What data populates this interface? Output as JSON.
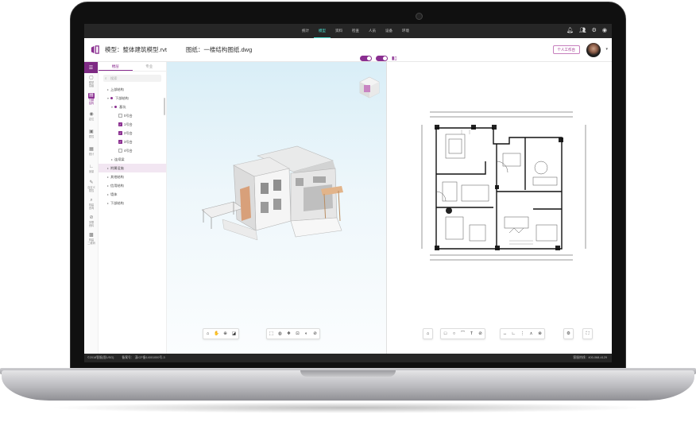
{
  "nav": {
    "links": [
      "统计",
      "模型",
      "资料",
      "检查",
      "人员",
      "设备",
      "环境"
    ],
    "active_index": 1
  },
  "header": {
    "model_label": "模型：整体建筑模型.rvt",
    "drawing_label": "图纸：一楼结构图纸.dwg",
    "workbench_button": "个人工作台"
  },
  "rail": {
    "items": [
      {
        "icon": "cube-icon",
        "glyph": "▢",
        "label": "模型\n层级"
      },
      {
        "icon": "layers-icon",
        "glyph": "▤",
        "label": "分解\n结构",
        "active": true
      },
      {
        "icon": "pin-icon",
        "glyph": "◉",
        "label": "定位"
      },
      {
        "icon": "property-icon",
        "glyph": "▣",
        "label": "属性"
      },
      {
        "icon": "grid-icon",
        "glyph": "▦",
        "label": "统计"
      },
      {
        "icon": "measure-icon",
        "glyph": "∟",
        "label": "测量"
      },
      {
        "icon": "custom-icon",
        "glyph": "✎",
        "label": "自定义\n属性"
      },
      {
        "icon": "search-icon",
        "glyph": "⌕",
        "label": "构建\n查询"
      },
      {
        "icon": "link-icon",
        "glyph": "⊘",
        "label": "关联\n资料"
      },
      {
        "icon": "qr-icon",
        "glyph": "▩",
        "label": "构建\n二维码"
      }
    ]
  },
  "tree": {
    "tabs": [
      "楼层",
      "专业"
    ],
    "active_tab": 0,
    "search_placeholder": "搜索",
    "nodes": [
      {
        "label": "上部结构",
        "indent": 1,
        "arrow": "▸",
        "check": false
      },
      {
        "label": "下部结构",
        "indent": 1,
        "arrow": "▾",
        "check": false,
        "dot": true
      },
      {
        "label": "基坑",
        "indent": 2,
        "arrow": "▾",
        "check": false,
        "dot": true
      },
      {
        "label": "0号台",
        "indent": 3,
        "arrow": "",
        "check": false,
        "box": true
      },
      {
        "label": "1号台",
        "indent": 3,
        "arrow": "",
        "check": true,
        "box": true
      },
      {
        "label": "2号台",
        "indent": 3,
        "arrow": "",
        "check": true,
        "box": true
      },
      {
        "label": "3号台",
        "indent": 3,
        "arrow": "",
        "check": true,
        "box": true
      },
      {
        "label": "4号台",
        "indent": 3,
        "arrow": "",
        "check": false,
        "box": true
      },
      {
        "label": "连续梁",
        "indent": 2,
        "arrow": "▸",
        "check": false
      },
      {
        "label": "附属设施",
        "indent": 1,
        "arrow": "▸",
        "check": false,
        "selected": true
      },
      {
        "label": "其他结构",
        "indent": 1,
        "arrow": "▸",
        "check": false
      },
      {
        "label": "信用结构",
        "indent": 1,
        "arrow": "▸",
        "check": false
      },
      {
        "label": "墙体",
        "indent": 1,
        "arrow": "▸",
        "check": false
      },
      {
        "label": "下部结构",
        "indent": 1,
        "arrow": "▸",
        "check": false
      }
    ]
  },
  "viewer": {
    "toggle_labels": [
      "2D"
    ]
  },
  "toolbar3d": {
    "group1": [
      {
        "icon": "home-icon",
        "glyph": "⌂"
      },
      {
        "icon": "pan-hand-icon",
        "glyph": "✋"
      },
      {
        "icon": "zoom-icon",
        "glyph": "⊕"
      },
      {
        "icon": "fit-icon",
        "glyph": "◪"
      }
    ],
    "group2": [
      {
        "icon": "select-icon",
        "glyph": "⬚"
      },
      {
        "icon": "section-icon",
        "glyph": "◍"
      },
      {
        "icon": "explode-icon",
        "glyph": "❖"
      },
      {
        "icon": "measure-icon",
        "glyph": "⊡"
      },
      {
        "icon": "render-icon",
        "glyph": "◐"
      },
      {
        "icon": "hide-icon",
        "glyph": "⊘"
      }
    ]
  },
  "toolbar2d": {
    "group1": [
      {
        "icon": "home-icon",
        "glyph": "⌂"
      }
    ],
    "group2": [
      {
        "icon": "rect-icon",
        "glyph": "□"
      },
      {
        "icon": "ellipse-icon",
        "glyph": "○"
      },
      {
        "icon": "polyline-icon",
        "glyph": "⌒"
      },
      {
        "icon": "text-icon",
        "glyph": "T"
      },
      {
        "icon": "hide-icon",
        "glyph": "⊘"
      }
    ],
    "group3": [
      {
        "icon": "dim-linear-icon",
        "glyph": "↔"
      },
      {
        "icon": "dim-angle-icon",
        "glyph": "∟"
      },
      {
        "icon": "dim-radius-icon",
        "glyph": "⋮"
      },
      {
        "icon": "dim-arc-icon",
        "glyph": "⋏"
      },
      {
        "icon": "dim-clear-icon",
        "glyph": "⊗"
      }
    ],
    "group4": [
      {
        "icon": "settings-icon",
        "glyph": "⚙"
      }
    ],
    "group5": [
      {
        "icon": "fullscreen-icon",
        "glyph": "⛶"
      }
    ]
  },
  "footer": {
    "left": "©2018智服(智USG)",
    "icp_label": "备案号：",
    "icp": "滇ICP备14001000号-3",
    "right": "客服热线：400-068-4129"
  },
  "colors": {
    "accent": "#8a2e90",
    "nav_active": "#4be0d0",
    "nav_bg": "#262626"
  }
}
